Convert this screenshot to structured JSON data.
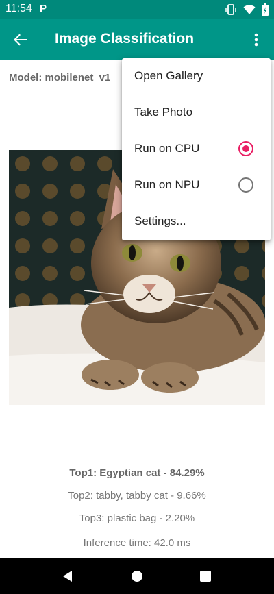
{
  "status_bar": {
    "time": "11:54",
    "notification_icon": "P"
  },
  "app_bar": {
    "title": "Image Classification",
    "back_icon": "arrow-back-icon",
    "overflow_icon": "more-vert-icon"
  },
  "model": {
    "label": "Model: mobilenet_v1"
  },
  "results": {
    "top1": "Top1:  Egyptian cat - 84.29%",
    "top2": "Top2:  tabby, tabby cat - 9.66%",
    "top3": "Top3:  plastic bag - 2.20%",
    "inference_time": "Inference time: 42.0 ms"
  },
  "menu": {
    "items": [
      {
        "label": "Open Gallery"
      },
      {
        "label": "Take Photo"
      },
      {
        "label": "Run on CPU",
        "radio": true,
        "checked": true
      },
      {
        "label": "Run on NPU",
        "radio": true,
        "checked": false
      },
      {
        "label": "Settings..."
      }
    ]
  },
  "colors": {
    "status_bar": "#00897b",
    "app_bar": "#009688",
    "radio_accent": "#e91e63"
  }
}
